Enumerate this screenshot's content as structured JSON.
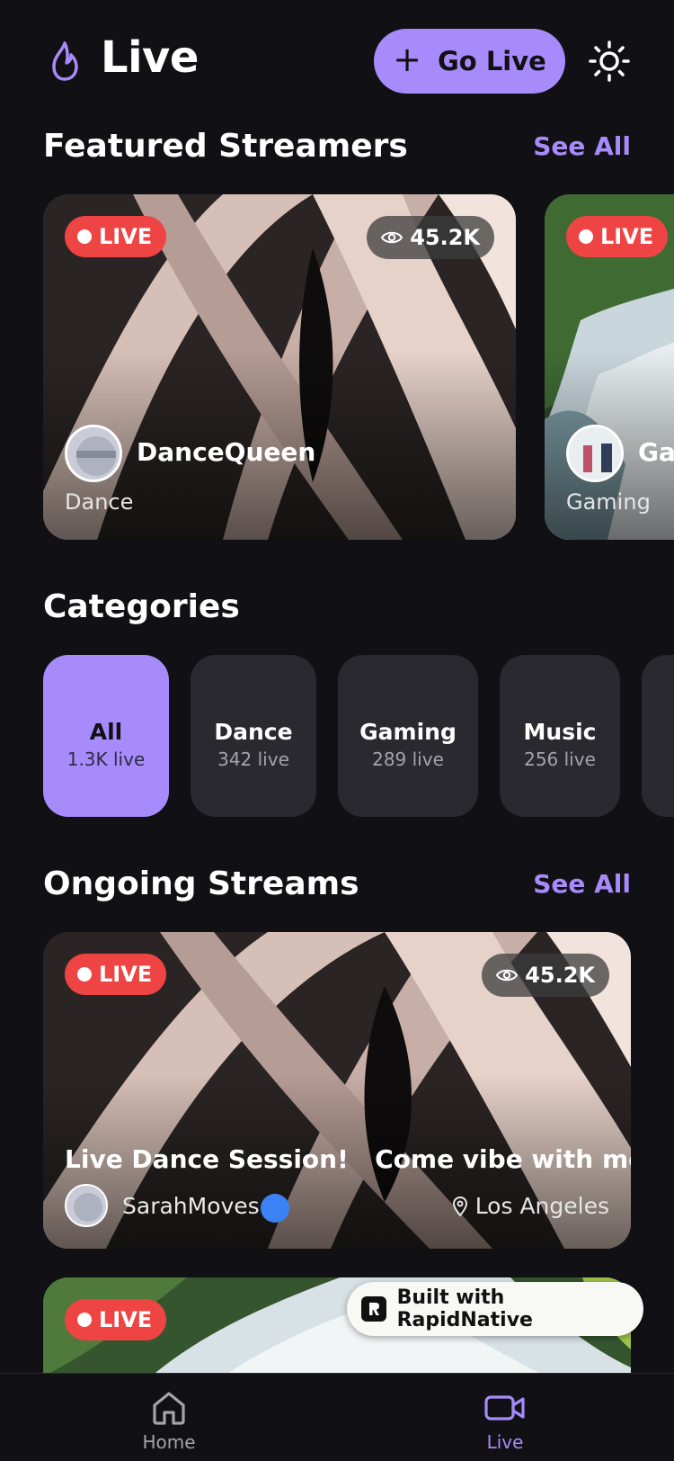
{
  "header": {
    "title": "Live",
    "go_live_label": "Go Live",
    "icons": {
      "brand": "flame-icon",
      "add": "plus-icon",
      "theme": "sun-icon"
    }
  },
  "featured": {
    "title": "Featured Streamers",
    "see_all": "See All",
    "cards": [
      {
        "badge": "LIVE",
        "viewers": "45.2K",
        "name": "DanceQueen",
        "category": "Dance"
      },
      {
        "badge": "LIVE",
        "name": "Ga",
        "category": "Gaming"
      }
    ]
  },
  "categories": {
    "title": "Categories",
    "items": [
      {
        "name": "All",
        "count": "1.3K live"
      },
      {
        "name": "Dance",
        "count": "342 live"
      },
      {
        "name": "Gaming",
        "count": "289 live"
      },
      {
        "name": "Music",
        "count": "256 live"
      }
    ]
  },
  "ongoing": {
    "title": "Ongoing Streams",
    "see_all": "See All",
    "streams": [
      {
        "badge": "LIVE",
        "viewers": "45.2K",
        "title": "Live Dance Session!   Come vibe with me",
        "user": "SarahMoves",
        "location": "Los Angeles"
      },
      {
        "badge": "LIVE"
      }
    ]
  },
  "built_with": "Built with RapidNative",
  "tabs": [
    {
      "label": "Home",
      "icon": "home-icon"
    },
    {
      "label": "Live",
      "icon": "video-camera-icon"
    }
  ],
  "colors": {
    "background": "#111015",
    "accent": "#a78bfa",
    "live_red": "#ef4444",
    "chip": "#2a2930",
    "verified": "#3b82f6"
  }
}
